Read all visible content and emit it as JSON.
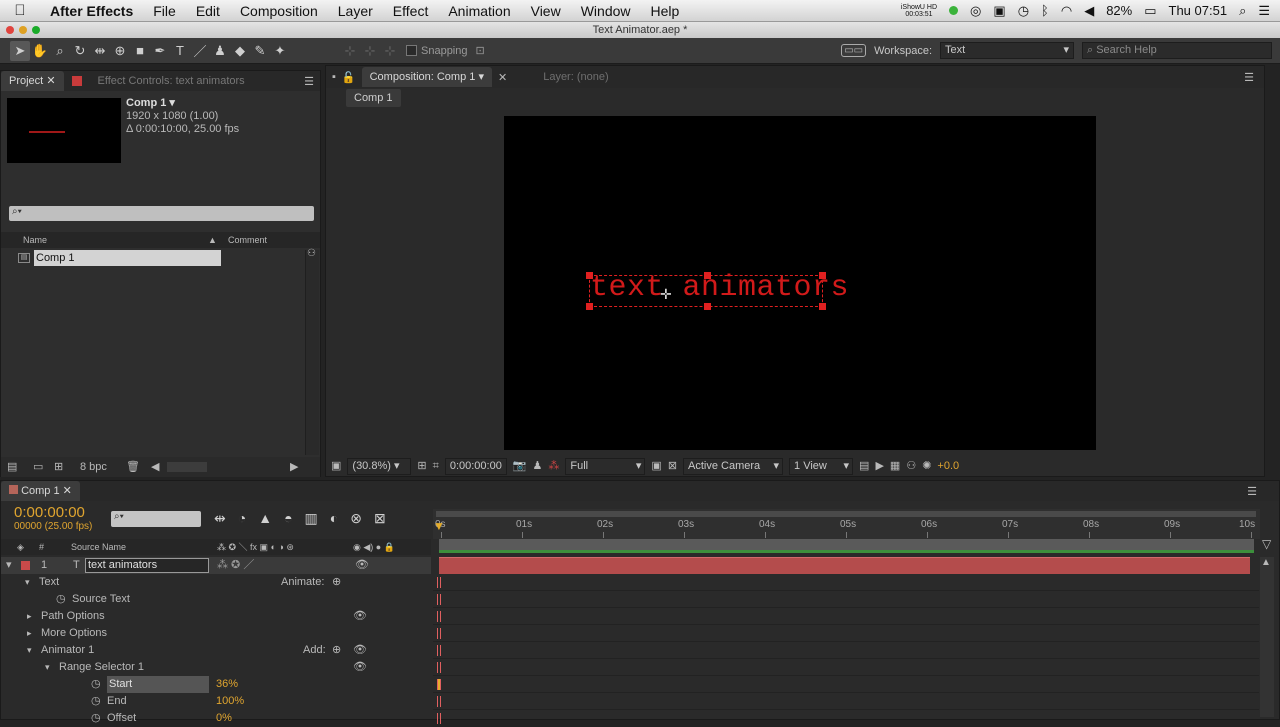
{
  "menubar": {
    "app_name": "After Effects",
    "items": [
      "File",
      "Edit",
      "Composition",
      "Layer",
      "Effect",
      "Animation",
      "View",
      "Window",
      "Help"
    ],
    "showu_line1": "iShowU HD",
    "showu_line2": "00:03:51",
    "battery": "82%",
    "clock": "Thu 07:51"
  },
  "window": {
    "title": "Text Animator.aep *"
  },
  "toolbar": {
    "snapping_label": "Snapping",
    "workspace_label": "Workspace:",
    "workspace_value": "Text",
    "search_placeholder": "Search Help"
  },
  "project_panel": {
    "tab_project": "Project",
    "tab_effect_controls": "Effect Controls: text animators",
    "comp_name": "Comp 1 ▾",
    "comp_size": "1920 x 1080 (1.00)",
    "comp_duration": "Δ 0:00:10:00, 25.00 fps",
    "col_name": "Name",
    "col_comment": "Comment",
    "item_name": "Comp 1",
    "bpc": "8 bpc"
  },
  "comp_panel": {
    "tab_label": "Composition: Comp 1",
    "layer_tab": "Layer: (none)",
    "breadcrumb": "Comp 1",
    "canvas_text": "text animators",
    "zoom": "(30.8%)",
    "timecode": "0:00:00:00",
    "resolution": "Full",
    "camera": "Active Camera",
    "views": "1 View",
    "exposure": "+0.0"
  },
  "timeline": {
    "tab_label": "Comp 1",
    "current_time": "0:00:00:00",
    "frame_info": "00000 (25.00 fps)",
    "col_source_name": "Source Name",
    "layer_number": "1",
    "layer_name": "text animators",
    "ruler_ticks": [
      "0s",
      "01s",
      "02s",
      "03s",
      "04s",
      "05s",
      "06s",
      "07s",
      "08s",
      "09s",
      "10s"
    ],
    "props": [
      {
        "label": "Text",
        "extra": "Animate:",
        "value": ""
      },
      {
        "label": "Source Text",
        "extra": "",
        "value": ""
      },
      {
        "label": "Path Options",
        "extra": "",
        "value": ""
      },
      {
        "label": "More Options",
        "extra": "",
        "value": ""
      },
      {
        "label": "Animator 1",
        "extra": "Add:",
        "value": ""
      },
      {
        "label": "Range Selector 1",
        "extra": "",
        "value": ""
      },
      {
        "label": "Start",
        "extra": "",
        "value": "36%"
      },
      {
        "label": "End",
        "extra": "",
        "value": "100%"
      },
      {
        "label": "Offset",
        "extra": "",
        "value": "0%"
      }
    ]
  },
  "colors": {
    "accent_orange": "#e0a52f",
    "label_red": "#c84a4a",
    "text_red": "#d11a1a"
  }
}
